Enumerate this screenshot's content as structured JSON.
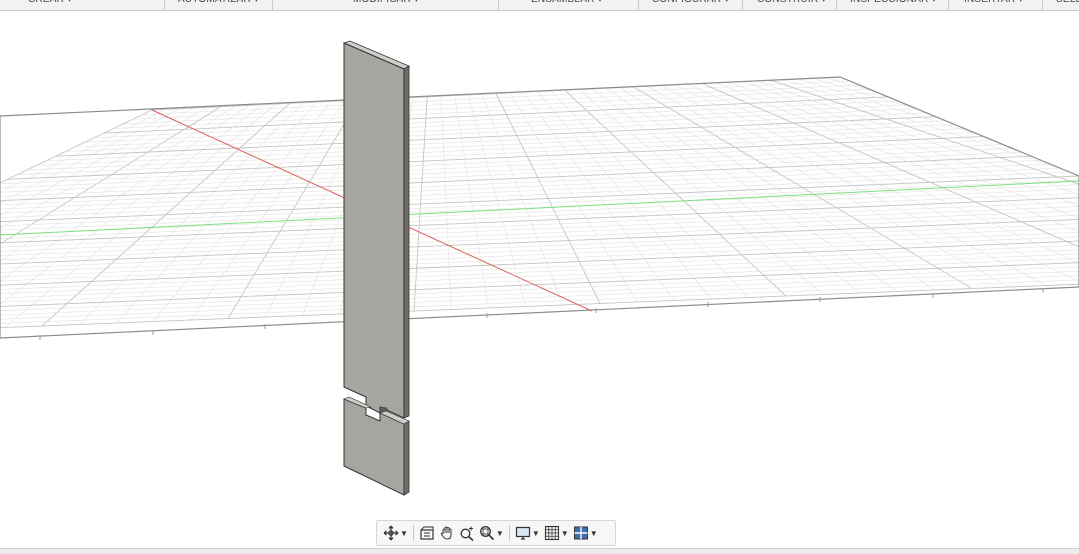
{
  "toolbar": {
    "menus": [
      {
        "label": "CREAR ▾"
      },
      {
        "label": "AUTOMATIZAR ▾"
      },
      {
        "label": "MODIFICAR ▾"
      },
      {
        "label": "ENSAMBLAR ▾"
      },
      {
        "label": "CONFIGURAR ▾"
      },
      {
        "label": "CONSTRUIR ▾"
      },
      {
        "label": "INSPECCIONAR ▾"
      },
      {
        "label": "INSERTAR ▾"
      },
      {
        "label": "SELE"
      }
    ]
  },
  "viewport": {
    "colors": {
      "grid_minor": "#e2e2e2",
      "grid_major": "#c4c4c4",
      "x_axis": "#e0605a",
      "y_axis": "#7fe07f",
      "body_face": "#a6a59f",
      "body_side": "#7d7c77"
    }
  },
  "nav_toolbar": {
    "buttons": [
      {
        "icon": "orbit-icon",
        "has_dropdown": true
      },
      {
        "icon": "look-at-icon",
        "has_dropdown": false
      },
      {
        "icon": "pan-hand-icon",
        "has_dropdown": false
      },
      {
        "icon": "zoom-icon",
        "has_dropdown": false
      },
      {
        "icon": "fit-zoom-icon",
        "has_dropdown": true
      },
      {
        "icon": "display-settings-icon",
        "has_dropdown": true
      },
      {
        "icon": "grid-settings-icon",
        "has_dropdown": true
      },
      {
        "icon": "viewports-icon",
        "has_dropdown": true
      }
    ]
  }
}
